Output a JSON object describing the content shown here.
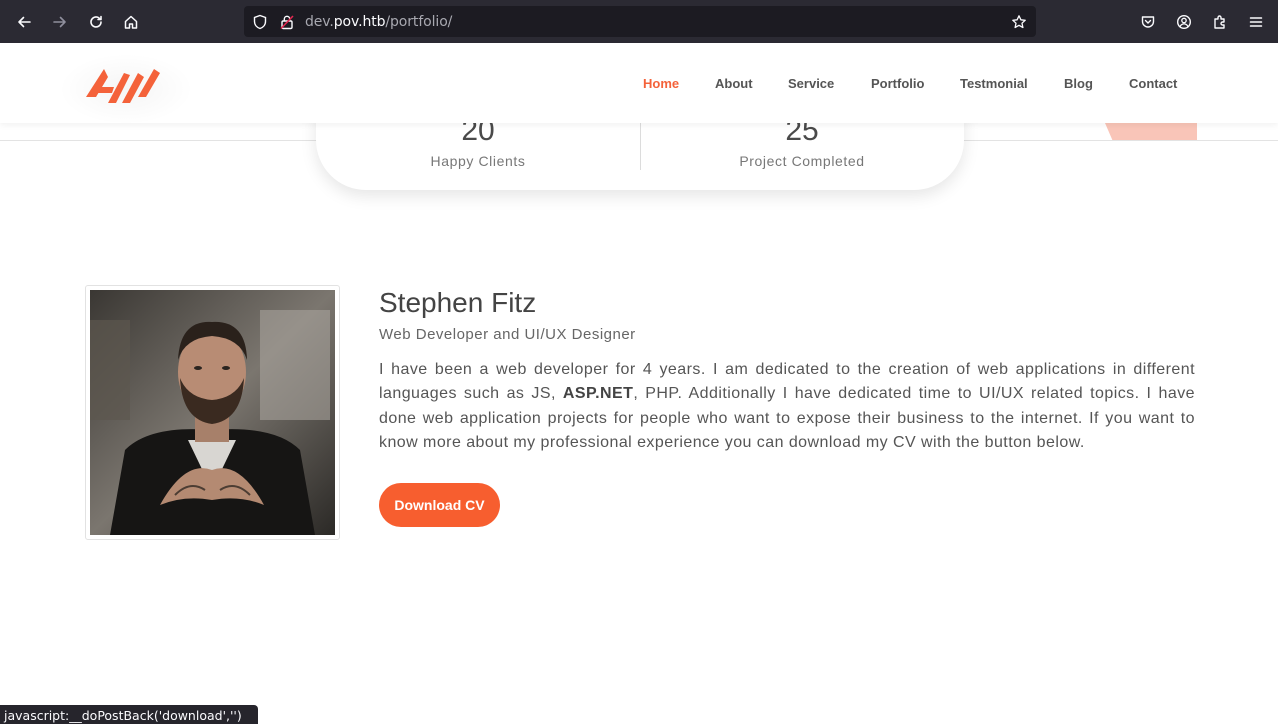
{
  "browser": {
    "url_host_prefix": "dev.",
    "url_host_main": "pov.htb",
    "url_path": "/portfolio/",
    "status_text": "javascript:__doPostBack('download','')"
  },
  "nav": {
    "items": [
      {
        "label": "Home",
        "active": true
      },
      {
        "label": "About"
      },
      {
        "label": "Service"
      },
      {
        "label": "Portfolio"
      },
      {
        "label": "Testmonial"
      },
      {
        "label": "Blog"
      },
      {
        "label": "Contact"
      }
    ]
  },
  "stats": [
    {
      "value": "20",
      "label": "Happy Clients"
    },
    {
      "value": "25",
      "label": "Project Completed"
    }
  ],
  "profile": {
    "name": "Stephen Fitz",
    "title": "Web Developer and UI/UX Designer",
    "bio_part1": "I have been a web developer for 4 years. I am dedicated to the creation of web applications in different languages such as JS, ",
    "bio_bold": "ASP.NET",
    "bio_part2": ", PHP. Additionally I have dedicated time to UI/UX related topics. I have done web application projects for people who want to expose their business to the internet. If you want to know more about my professional experience you can download my CV with the button below.",
    "download_label": "Download CV"
  },
  "colors": {
    "accent": "#f4623a",
    "button": "#f75e2f",
    "browser_chrome": "#2b2a33"
  }
}
